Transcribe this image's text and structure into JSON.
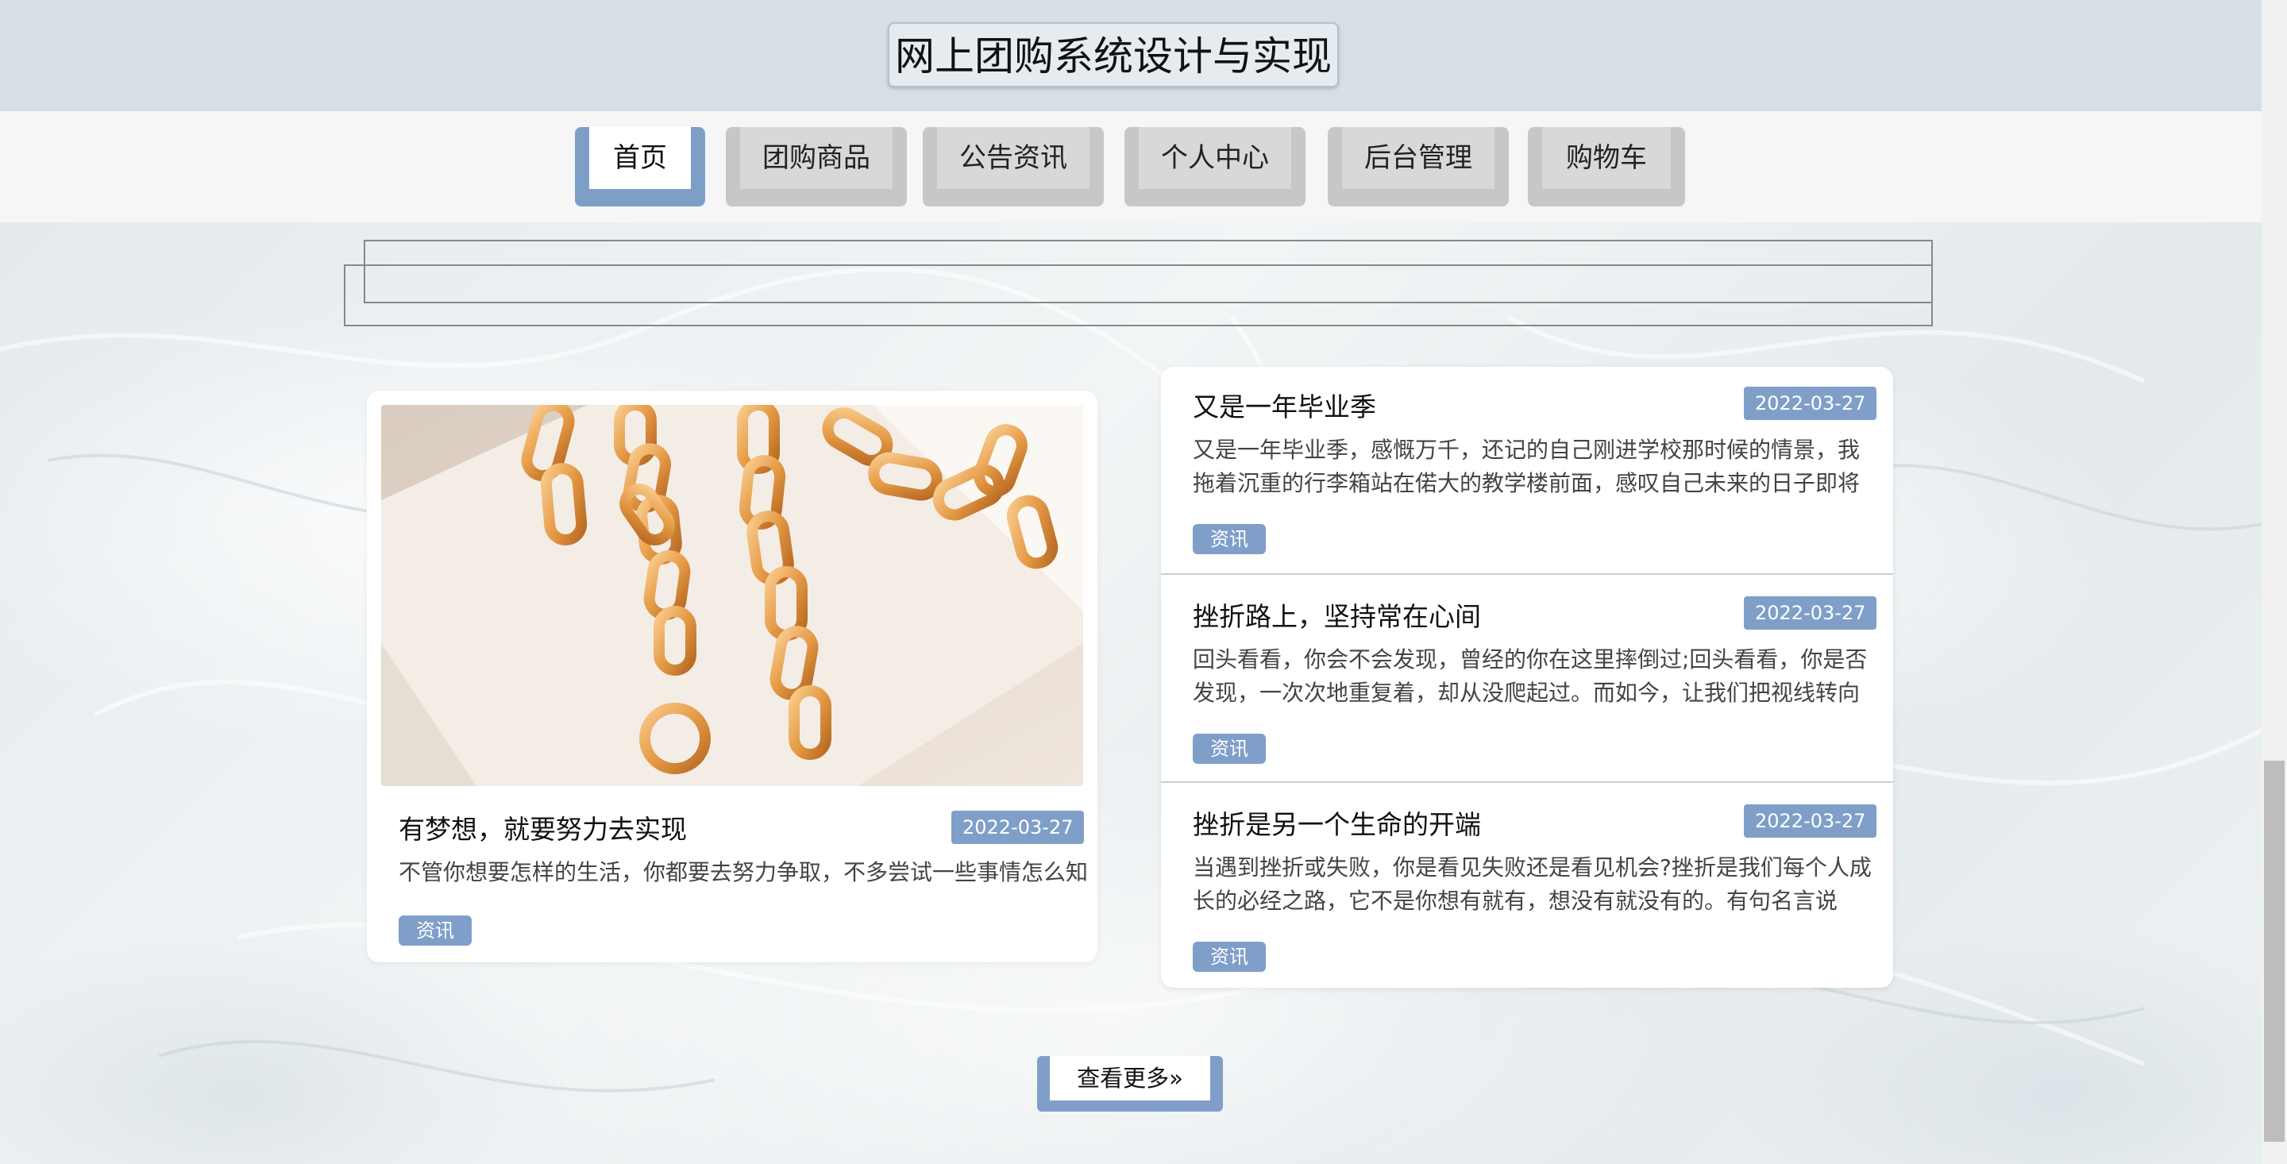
{
  "header": {
    "title": "网上团购系统设计与实现"
  },
  "nav": {
    "items": [
      {
        "label": "首页",
        "active": true
      },
      {
        "label": "团购商品",
        "active": false
      },
      {
        "label": "公告资讯",
        "active": false
      },
      {
        "label": "个人中心",
        "active": false
      },
      {
        "label": "后台管理",
        "active": false
      },
      {
        "label": "购物车",
        "active": false
      }
    ]
  },
  "featured": {
    "title": "有梦想，就要努力去实现",
    "date": "2022-03-27",
    "excerpt": "不管你想要怎样的生活，你都要去努力争取，不多尝试一些事情怎么知",
    "tag": "资讯"
  },
  "news": [
    {
      "title": "又是一年毕业季",
      "date": "2022-03-27",
      "excerpt": "又是一年毕业季，感慨万千，还记的自己刚进学校那时候的情景，我拖着沉重的行李箱站在偌大的教学楼前面，感叹自己未来的日子即将在…",
      "tag": "资讯"
    },
    {
      "title": "挫折路上，坚持常在心间",
      "date": "2022-03-27",
      "excerpt": "回头看看，你会不会发现，曾经的你在这里摔倒过;回头看看，你是否发现，一次次地重复着，却从没爬起过。而如今，让我们把视线转向前…",
      "tag": "资讯"
    },
    {
      "title": "挫折是另一个生命的开端",
      "date": "2022-03-27",
      "excerpt": "当遇到挫折或失败，你是看见失败还是看见机会?挫折是我们每个人成长的必经之路，它不是你想有就有，想没有就没有的。有句名言说的…",
      "tag": "资讯"
    }
  ],
  "more_button": {
    "label": "查看更多"
  },
  "colors": {
    "accent": "#7f9fc8",
    "header_bg": "#d7dee6"
  }
}
